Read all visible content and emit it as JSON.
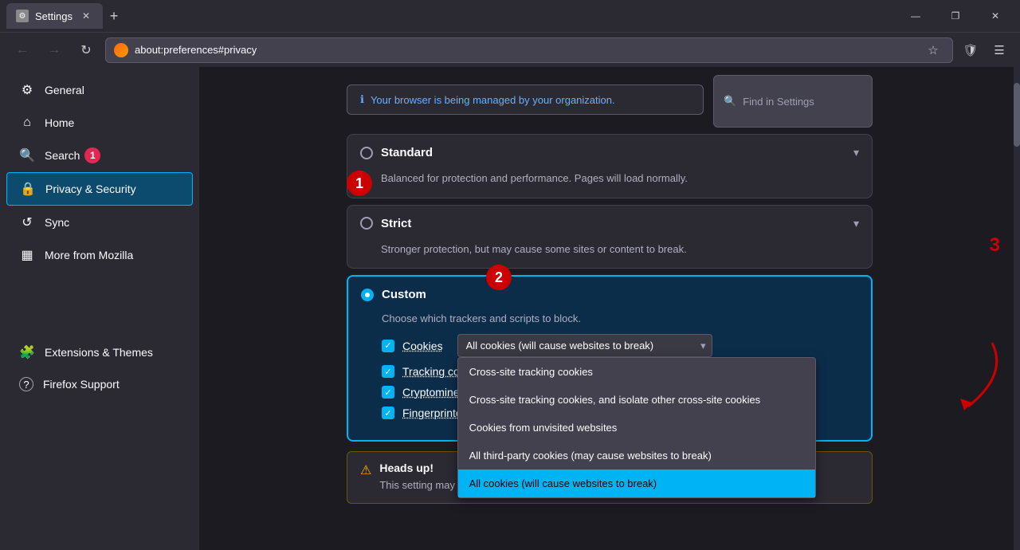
{
  "titlebar": {
    "tab_label": "Settings",
    "new_tab_icon": "+",
    "minimize": "—",
    "restore": "❐",
    "close": "✕"
  },
  "navbar": {
    "back_label": "←",
    "forward_label": "→",
    "reload_label": "↻",
    "address": "about:preferences#privacy",
    "browser_name": "Firefox"
  },
  "managed_banner": {
    "text": "Your browser is being managed by your organization."
  },
  "find_bar": {
    "placeholder": "Find in Settings"
  },
  "sidebar": {
    "items": [
      {
        "id": "general",
        "icon": "⚙",
        "label": "General"
      },
      {
        "id": "home",
        "icon": "⌂",
        "label": "Home"
      },
      {
        "id": "search",
        "icon": "🔍",
        "label": "Search",
        "badge": "1"
      },
      {
        "id": "privacy",
        "icon": "🔒",
        "label": "Privacy & Security",
        "active": true
      },
      {
        "id": "sync",
        "icon": "↺",
        "label": "Sync"
      },
      {
        "id": "mozilla",
        "icon": "▦",
        "label": "More from Mozilla"
      }
    ],
    "bottom_items": [
      {
        "id": "extensions",
        "icon": "🧩",
        "label": "Extensions & Themes"
      },
      {
        "id": "support",
        "icon": "?",
        "label": "Firefox Support"
      }
    ]
  },
  "sections": {
    "standard": {
      "title": "Standard",
      "desc": "Balanced for protection and performance. Pages will load normally."
    },
    "strict": {
      "title": "Strict",
      "desc": "Stronger protection, but may cause some sites or content to break."
    },
    "custom": {
      "title": "Custom",
      "choose_text": "Choose which trackers and scripts to block.",
      "checkboxes": [
        {
          "id": "cookies",
          "label": "Cookies"
        },
        {
          "id": "tracking",
          "label": "Tracking content"
        },
        {
          "id": "cryptominers",
          "label": "Cryptominers"
        },
        {
          "id": "fingerprinters",
          "label": "Fingerprinters"
        }
      ],
      "dropdown_selected": "All cookies (will cause websites to break)",
      "dropdown_options": [
        "Cross-site tracking cookies",
        "Cross-site tracking cookies, and isolate other cross-site cookies",
        "Cookies from unvisited websites",
        "All third-party cookies (may cause websites to break)",
        "All cookies (will cause websites to break)"
      ]
    }
  },
  "heads_up": {
    "title": "Heads up!",
    "text": "This setting may cause some websites to not display content or work correctly. If"
  },
  "annotations": {
    "label_1": "1",
    "label_2": "2",
    "label_3": "3"
  }
}
